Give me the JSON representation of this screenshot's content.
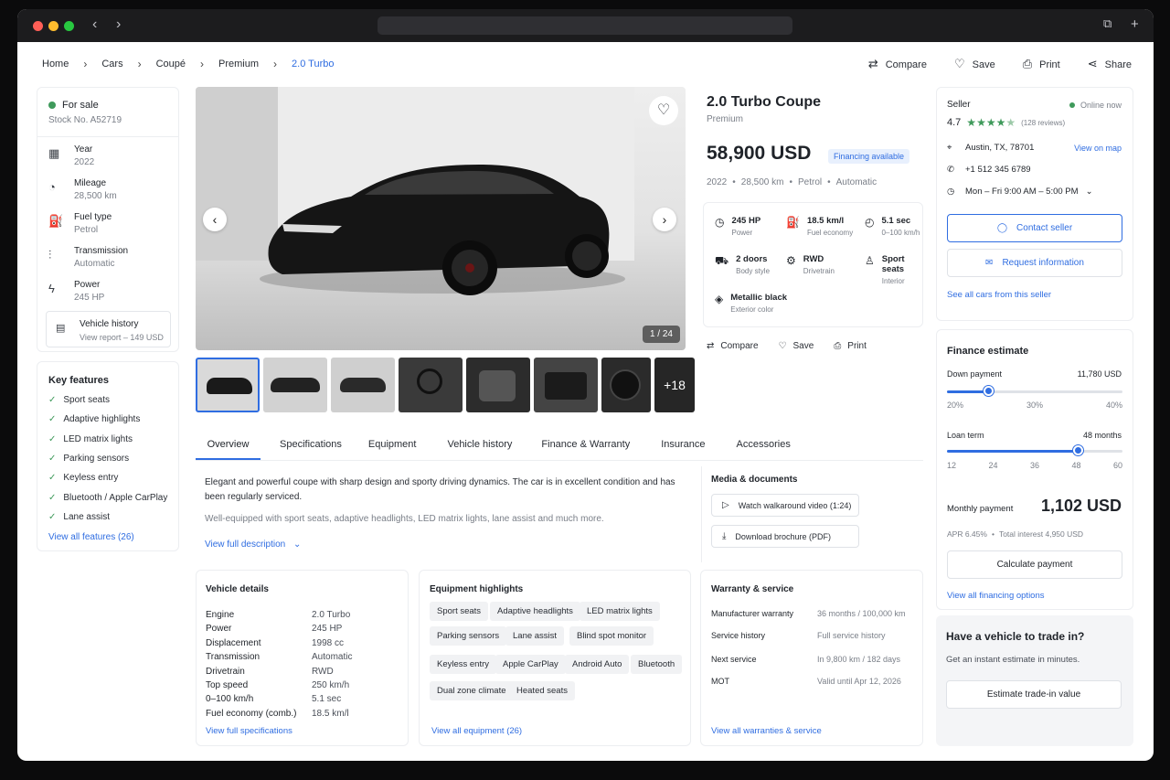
{
  "breadcrumb": [
    "Home",
    "Cars",
    "Coupé",
    "Premium",
    "2.0 Turbo"
  ],
  "top_actions": {
    "compare": "Compare",
    "save": "Save",
    "print": "Print",
    "share": "Share"
  },
  "status": {
    "label": "For sale",
    "stock": "Stock No. A52719",
    "color": "#3f9a5b"
  },
  "specs": [
    {
      "icon": "calendar-icon",
      "label": "Year",
      "value": "2022"
    },
    {
      "icon": "speedometer-icon",
      "label": "Mileage",
      "value": "28,500 km"
    },
    {
      "icon": "fuel-icon",
      "label": "Fuel type",
      "value": "Petrol"
    },
    {
      "icon": "transmission-icon",
      "label": "Transmission",
      "value": "Automatic"
    },
    {
      "icon": "bolt-icon",
      "label": "Power",
      "value": "245 HP"
    }
  ],
  "vehicle_history": {
    "title": "Vehicle history",
    "sub": "View report – 149 USD"
  },
  "key_features": {
    "title": "Key features",
    "items": [
      "Sport seats",
      "Adaptive highlights",
      "LED matrix lights",
      "Parking sensors",
      "Keyless entry",
      "Bluetooth / Apple CarPlay",
      "Lane assist"
    ],
    "link": "View all features (26)"
  },
  "gallery": {
    "counter": "1 / 24",
    "more": "+18"
  },
  "car": {
    "title": "2.0 Turbo Coupe",
    "trim": "Premium",
    "price": "58,900 USD",
    "financing_badge": "Financing available",
    "meta": [
      "2022",
      "28,500 km",
      "Petrol",
      "Automatic"
    ]
  },
  "highlights": [
    {
      "icon": "gauge-icon",
      "value": "245 HP",
      "label": "Power"
    },
    {
      "icon": "fuel-pump-icon",
      "value": "18.5 km/l",
      "label": "Fuel economy"
    },
    {
      "icon": "timer-icon",
      "value": "5.1 sec",
      "label": "0–100 km/h"
    },
    {
      "icon": "car-icon",
      "value": "2 doors",
      "label": "Body style"
    },
    {
      "icon": "drivetrain-icon",
      "value": "RWD",
      "label": "Drivetrain"
    },
    {
      "icon": "seat-icon",
      "value": "Sport seats",
      "label": "Interior"
    },
    {
      "icon": "palette-icon",
      "value": "Metallic black",
      "label": "Exterior color"
    }
  ],
  "mid_actions": {
    "compare": "Compare",
    "save": "Save",
    "print": "Print"
  },
  "tabs": [
    "Overview",
    "Specifications",
    "Equipment",
    "Vehicle history",
    "Finance & Warranty",
    "Insurance",
    "Accessories"
  ],
  "overview": {
    "p1": "Elegant and powerful coupe with sharp design and sporty driving dynamics. The car is in excellent condition and has been regularly serviced.",
    "p2": "Well-equipped with sport seats, adaptive headlights, LED matrix lights, lane assist and much more.",
    "link": "View full description"
  },
  "media": {
    "title": "Media & documents",
    "video": "Watch walkaround video (1:24)",
    "brochure": "Download brochure (PDF)"
  },
  "vehicle_details": {
    "title": "Vehicle details",
    "rows": [
      [
        "Engine",
        "2.0 Turbo"
      ],
      [
        "Power",
        "245 HP"
      ],
      [
        "Displacement",
        "1998 cc"
      ],
      [
        "Transmission",
        "Automatic"
      ],
      [
        "Drivetrain",
        "RWD"
      ],
      [
        "Top speed",
        "250 km/h"
      ],
      [
        "0–100 km/h",
        "5.1 sec"
      ],
      [
        "Fuel economy (comb.)",
        "18.5 km/l"
      ]
    ],
    "link": "View full specifications"
  },
  "equipment": {
    "title": "Equipment highlights",
    "chips": [
      "Sport seats",
      "Adaptive headlights",
      "LED matrix lights",
      "Parking sensors",
      "Lane assist",
      "Blind spot monitor",
      "Keyless entry",
      "Apple CarPlay",
      "Android Auto",
      "Bluetooth",
      "Dual zone climate",
      "Heated seats"
    ],
    "link": "View all equipment (26)"
  },
  "warranty": {
    "title": "Warranty & service",
    "rows": [
      [
        "Manufacturer warranty",
        "36 months / 100,000 km"
      ],
      [
        "Service history",
        "Full service history"
      ],
      [
        "Next service",
        "In 9,800 km / 182 days"
      ],
      [
        "MOT",
        "Valid until Apr 12, 2026"
      ]
    ],
    "link": "View all warranties & service"
  },
  "seller": {
    "title": "Seller",
    "online": "Online now",
    "rating": "4.7",
    "stars": 4.5,
    "reviews": "(128 reviews)",
    "location": "Austin, TX, 78701",
    "map_link": "View on map",
    "phone": "+1 512 345 6789",
    "hours": "Mon – Fri 9:00 AM – 5:00 PM",
    "contact": "Contact seller",
    "request": "Request information",
    "all_cars": "See all cars from this seller"
  },
  "finance": {
    "title": "Finance estimate",
    "down_label": "Down payment",
    "down_value": "11,780 USD",
    "down_ticks": [
      "20%",
      "30%",
      "40%"
    ],
    "down_fraction": 0.24,
    "term_label": "Loan term",
    "term_value": "48 months",
    "term_ticks": [
      "12",
      "24",
      "36",
      "48",
      "60"
    ],
    "term_fraction": 0.75,
    "monthly_label": "Monthly payment",
    "monthly_value": "1,102 USD",
    "apr": "APR 6.45%",
    "interest": "Total interest 4,950 USD",
    "calc": "Calculate payment",
    "link": "View all financing options"
  },
  "tradein": {
    "title": "Have a vehicle to trade in?",
    "sub": "Get an instant estimate in minutes.",
    "button": "Estimate trade-in value"
  }
}
